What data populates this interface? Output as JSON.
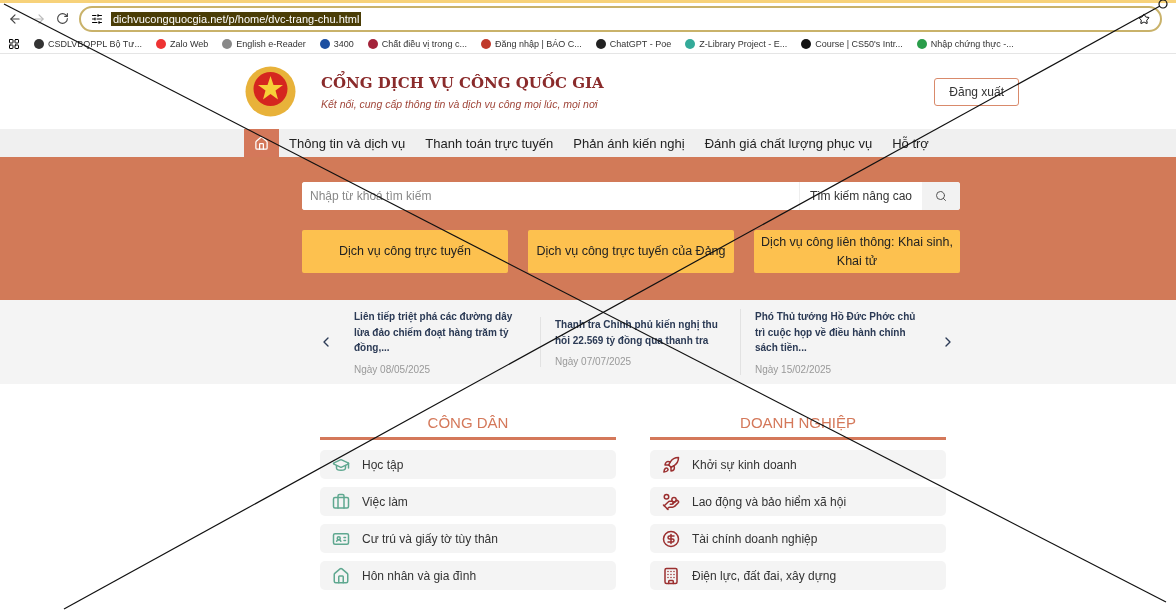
{
  "browser": {
    "url": "dichvucongquocgia.net/p/home/dvc-trang-chu.html",
    "bookmarks": [
      "CSDLVBQPPL Bộ Tư...",
      "Zalo Web",
      "English e-Reader",
      "3400",
      "Chất điều vị trong c...",
      "Đăng nhập | BÁO C...",
      "ChatGPT - Poe",
      "Z-Library Project - E...",
      "Course | CS50's Intr...",
      "Nhập chứng thực -..."
    ]
  },
  "header": {
    "title": "CỔNG DỊCH VỤ CÔNG QUỐC GIA",
    "subtitle": "Kết nối, cung cấp thông tin và dịch vụ công mọi lúc, mọi nơi",
    "logout_button": "Đăng xuất"
  },
  "nav": {
    "items": [
      {
        "kind": "home",
        "selected": true
      },
      {
        "kind": "link",
        "label": "Thông tin và dịch vụ",
        "selected": false
      },
      {
        "kind": "link",
        "label": "Thanh toán trực tuyến",
        "selected": false
      },
      {
        "kind": "link",
        "label": "Phản ánh kiến nghị",
        "selected": false
      },
      {
        "kind": "link",
        "label": "Đánh giá chất lượng phục vụ",
        "selected": false
      },
      {
        "kind": "link",
        "label": "Hỗ trợ",
        "selected": false
      }
    ]
  },
  "hero": {
    "search": {
      "placeholder": "Nhập từ khoá tìm kiếm"
    },
    "advanced_search": "Tìm kiếm nâng cao",
    "buttons": [
      "Dịch vụ công trực tuyến",
      "Dịch vụ công trực tuyến của Đảng",
      "Dịch vụ công liên thông: Khai sinh, Khai tử"
    ]
  },
  "news": [
    {
      "title": "Liên tiếp triệt phá các đường dây lừa đảo chiếm đoạt hàng trăm tỷ đồng,...",
      "date": "Ngày 08/05/2025"
    },
    {
      "title": "Thanh tra Chính phủ kiến nghị thu hồi 22.569 tỷ đồng qua thanh tra",
      "date": "Ngày 07/07/2025"
    },
    {
      "title": "Phó Thủ tướng Hồ Đức Phớc chủ trì cuộc họp về điều hành chính sách tiền...",
      "date": "Ngày 15/02/2025"
    }
  ],
  "sections": [
    {
      "title": "CÔNG DÂN",
      "items": [
        "Học tập",
        "Việc làm",
        "Cư trú và giấy tờ tùy thân",
        "Hôn nhân và gia đình"
      ]
    },
    {
      "title": "DOANH NGHIỆP",
      "items": [
        "Khởi sự kinh doanh",
        "Lao động và bảo hiểm xã hội",
        "Tài chính doanh nghiệp",
        "Điện lực, đất đai, xây dựng"
      ]
    }
  ]
}
